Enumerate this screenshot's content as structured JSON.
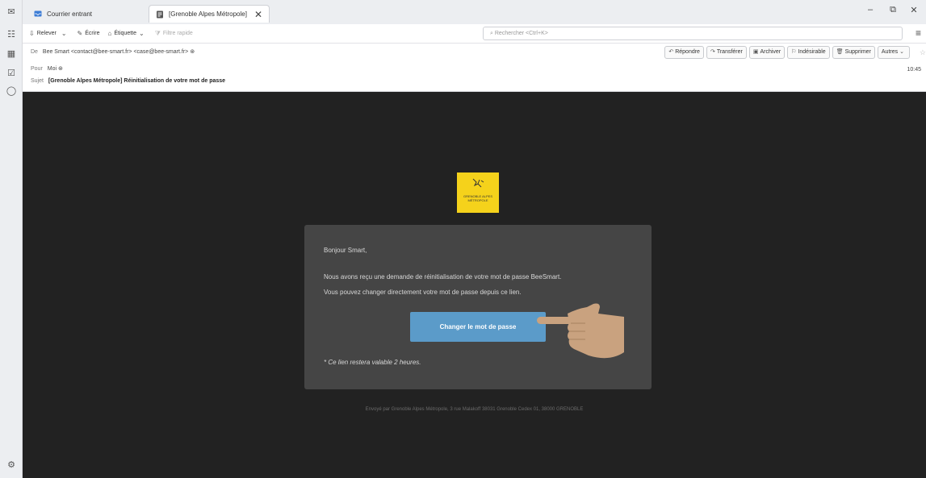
{
  "tabs": [
    {
      "label": "Courrier entrant",
      "icon": "inbox-icon"
    },
    {
      "label": "[Grenoble Alpes Métropole]",
      "icon": "message-icon"
    }
  ],
  "window_controls": {
    "minimize": "–",
    "restore": "⧉",
    "close": "✕"
  },
  "toolbar": {
    "get_messages": "Relever",
    "write": "Écrire",
    "tag": "Étiquette",
    "quick_filter": "Filtre rapide",
    "search_placeholder": "Rechercher <Ctrl+K>"
  },
  "header": {
    "from_label": "De",
    "from_value": "Bee Smart <contact@bee-smart.fr> <case@bee-smart.fr>",
    "to_label": "Pour",
    "to_value": "Moi",
    "subject_label": "Sujet",
    "subject_value": "[Grenoble Alpes Métropole] Réinitialisation de votre mot de passe",
    "time": "10:45",
    "actions": {
      "reply": "Répondre",
      "forward": "Transférer",
      "archive": "Archiver",
      "junk": "Indésirable",
      "delete": "Supprimer",
      "more": "Autres"
    }
  },
  "message": {
    "logo_text": "GRENOBLE ALPES MÉTROPOLE",
    "greeting": "Bonjour Smart,",
    "line1": "Nous avons reçu une demande de réinitialisation de votre mot de passe BeeSmart.",
    "line2": "Vous pouvez changer directement votre mot de passe depuis ce lien.",
    "button": "Changer le mot de passe",
    "note": "* Ce lien restera valable 2 heures.",
    "footer": "Envoyé par Grenoble Alpes Métropole, 3 rue Malakoff 38031 Grenoble Cedex 01, 38000 GRENOBLE"
  },
  "colors": {
    "body_background": "#222222",
    "card_background": "#454545",
    "button": "#5b9bc9",
    "logo_yellow": "#f5d21b",
    "hand_skin": "#c9a27f"
  }
}
